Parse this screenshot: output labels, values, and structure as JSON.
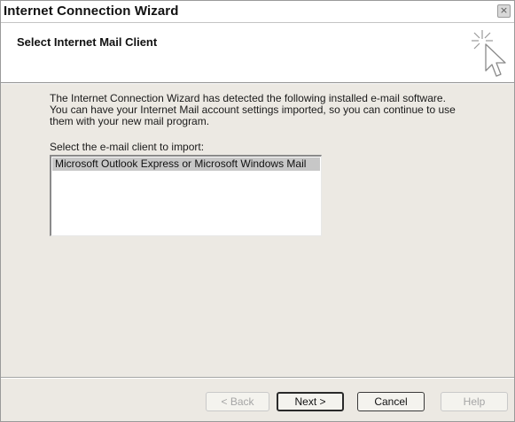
{
  "window": {
    "title": "Internet Connection Wizard",
    "close_glyph": "×"
  },
  "header": {
    "title": "Select Internet Mail Client",
    "icon": "wizard-cursor-icon"
  },
  "content": {
    "description": "The Internet Connection Wizard has detected the following installed e-mail software. You can have your Internet Mail account settings imported, so you can continue to use them with your new mail program.",
    "select_label": "Select the e-mail client to import:",
    "clients": [
      "Microsoft Outlook Express or Microsoft Windows Mail"
    ],
    "selected_client": "Microsoft Outlook Express or Microsoft Windows Mail"
  },
  "buttons": {
    "back": "< Back",
    "next": "Next >",
    "cancel": "Cancel",
    "help": "Help"
  }
}
